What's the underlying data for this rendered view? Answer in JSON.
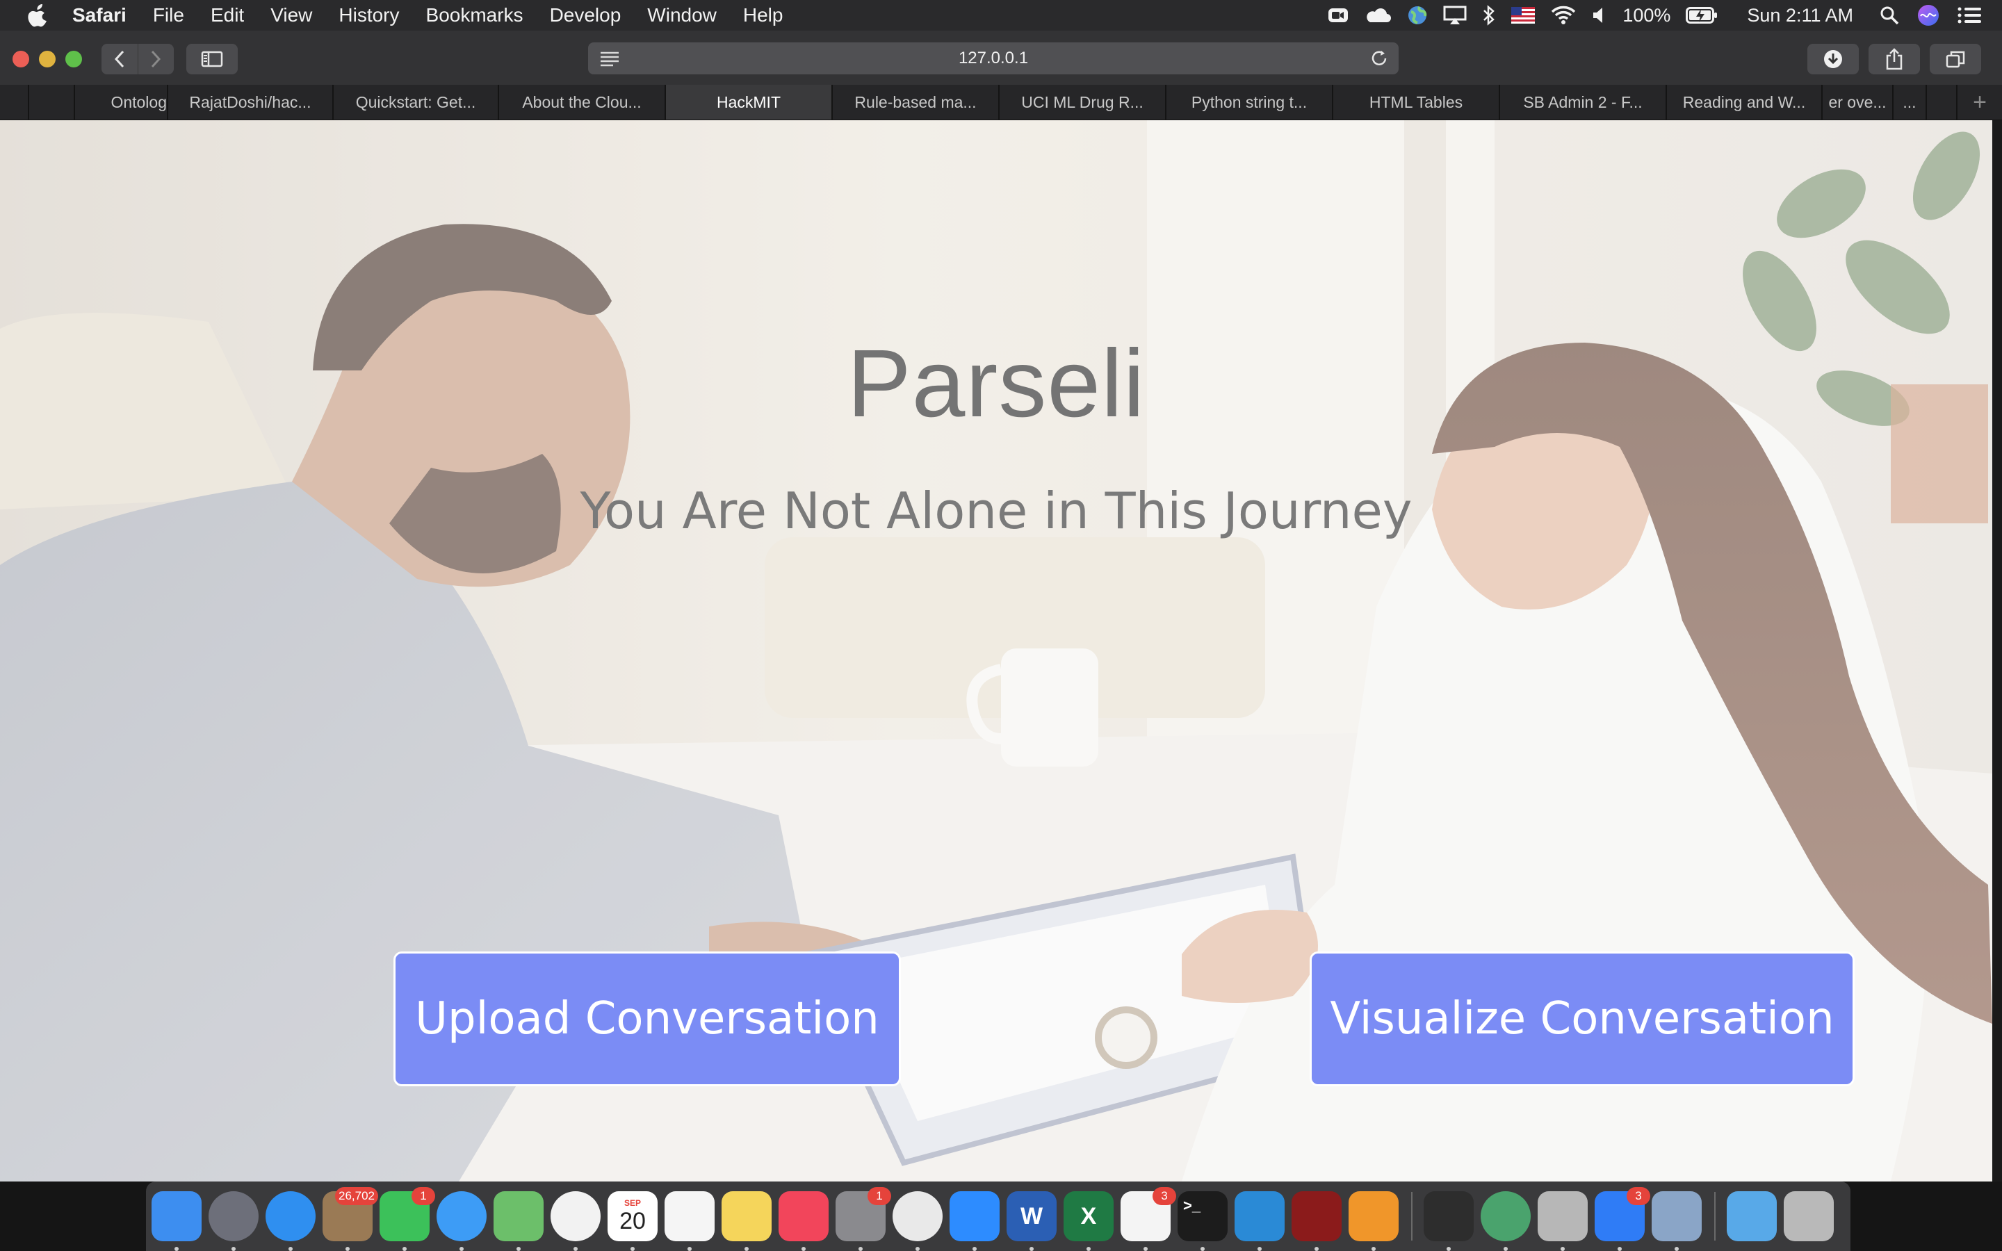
{
  "menubar": {
    "app_name": "Safari",
    "items": [
      "File",
      "Edit",
      "View",
      "History",
      "Bookmarks",
      "Develop",
      "Window",
      "Help"
    ],
    "battery": "100%",
    "clock": "Sun 2:11 AM"
  },
  "toolbar": {
    "url": "127.0.0.1"
  },
  "tabs": [
    {
      "label": ""
    },
    {
      "label": ""
    },
    {
      "label": "Ontolog"
    },
    {
      "label": "RajatDoshi/hac..."
    },
    {
      "label": "Quickstart: Get..."
    },
    {
      "label": "About the Clou..."
    },
    {
      "label": "HackMIT",
      "active": true
    },
    {
      "label": "Rule-based ma..."
    },
    {
      "label": "UCI ML Drug R..."
    },
    {
      "label": "Python string t..."
    },
    {
      "label": "HTML Tables"
    },
    {
      "label": "SB Admin 2 - F..."
    },
    {
      "label": "Reading and W..."
    },
    {
      "label": "er ove..."
    },
    {
      "label": "..."
    }
  ],
  "hero": {
    "title": "Parseli",
    "subtitle": "You Are Not Alone in This Journey",
    "upload_button": "Upload Conversation",
    "visualize_button": "Visualize Conversation"
  },
  "dock": {
    "apps": [
      {
        "name": "finder",
        "color": "#3d8ef0"
      },
      {
        "name": "launchpad",
        "color": "#6d6f7a"
      },
      {
        "name": "safari",
        "color": "#2f8ff0"
      },
      {
        "name": "mail",
        "color": "#9a7a55",
        "badge": "26,702"
      },
      {
        "name": "facetime",
        "color": "#3cc15a",
        "badge": "1"
      },
      {
        "name": "messages",
        "color": "#3d9cf6"
      },
      {
        "name": "maps",
        "color": "#6cbf6a"
      },
      {
        "name": "photos",
        "color": "#f2f2f2"
      },
      {
        "name": "calendar",
        "color": "#ffffff",
        "month": "SEP",
        "day": "20"
      },
      {
        "name": "reminders",
        "color": "#f5f5f5"
      },
      {
        "name": "notes",
        "color": "#f5d55b"
      },
      {
        "name": "music",
        "color": "#f2455b"
      },
      {
        "name": "system-preferences",
        "color": "#8a8a8e",
        "badge": "1"
      },
      {
        "name": "chrome",
        "color": "#e9e9e9"
      },
      {
        "name": "zoom",
        "color": "#2d8cff"
      },
      {
        "name": "word",
        "color": "#2b5fb4",
        "letter": "W"
      },
      {
        "name": "excel",
        "color": "#1f7a44",
        "letter": "X"
      },
      {
        "name": "slack",
        "color": "#f4f4f4",
        "badge": "3"
      },
      {
        "name": "terminal",
        "color": "#1c1c1c"
      },
      {
        "name": "vscode",
        "color": "#2a8ad6"
      },
      {
        "name": "activity-app",
        "color": "#8b1b1b"
      },
      {
        "name": "sublime-text",
        "color": "#f0962a"
      },
      {
        "name": "activity-monitor",
        "color": "#2d2d2d"
      },
      {
        "name": "network-app",
        "color": "#4aa36d"
      },
      {
        "name": "keychain-access",
        "color": "#b7b7b7"
      },
      {
        "name": "messenger",
        "color": "#2f7cf6",
        "badge": "3"
      },
      {
        "name": "preview",
        "color": "#8aa5c7"
      },
      {
        "name": "downloads-folder",
        "color": "#58a9e8"
      },
      {
        "name": "trash",
        "color": "#b9b9b9"
      }
    ]
  }
}
